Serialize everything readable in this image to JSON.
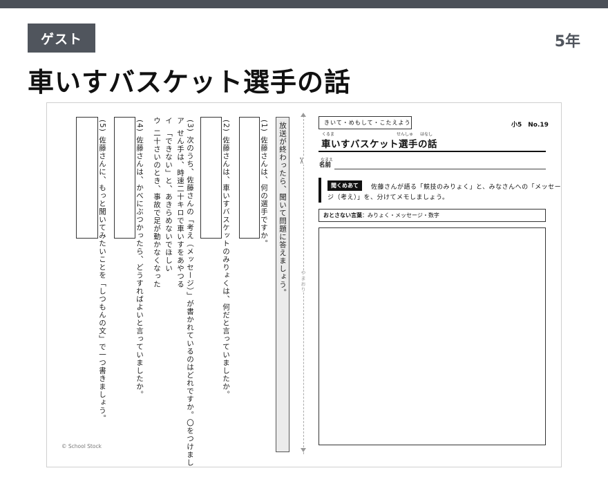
{
  "header": {
    "badge": "ゲスト",
    "grade": "5年",
    "title": "車いすバスケット選手の話"
  },
  "worksheet": {
    "instruction": "放送が終わったら、聞いて問題に答えましょう。",
    "questions": [
      {
        "num": "(1)",
        "text": "佐藤さんは、何の選手ですか。"
      },
      {
        "num": "(2)",
        "text": "佐藤さんは、車いすバスケットのみりょくは、何だと言っていましたか。"
      },
      {
        "num": "(3)",
        "text": "次のうち、佐藤さんの「考え（メッセージ）」が書かれているのはどれですか。〇をつけましょう。",
        "options": [
          {
            "label": "ア",
            "text": "せん手は、時速二十キロで車いすをあやつる"
          },
          {
            "label": "イ",
            "text": "「できない」と、あきらめないでほしい"
          },
          {
            "label": "ウ",
            "text": "二十さいのとき、事故で足が動かなくなった"
          }
        ]
      },
      {
        "num": "(4)",
        "text": "佐藤さんは、かべにぶつかったら、どうすればよいと言っていましたか。"
      },
      {
        "num": "(5)",
        "text": "佐藤さんに、もっと聞いてみたいことを「しつもんの文」で一つ書きましょう。"
      }
    ],
    "copyright": "© School Stock",
    "fold_label": "やまおり",
    "scissor": "✂",
    "right": {
      "tag": "きいて・めもして・こたえよう",
      "number": "小5　No.19",
      "title": "車いすバスケット選手の話",
      "title_ruby_kuruma": "くるま",
      "title_ruby_senshu": "せんしゅ",
      "title_ruby_hanashi": "はなし",
      "name_label": "名前",
      "name_ruby": "なまえ",
      "goal_label": "聞くめあて",
      "goal_line1": "佐藤さんが語る「競技のみりょく」と、みなさんへの「メッセー",
      "goal_line2": "ジ（考え）」を、分けてメモしましょう。",
      "keywords_label": "おとさない言葉",
      "keywords_text": "：みりょく・メッセージ・数字"
    }
  }
}
